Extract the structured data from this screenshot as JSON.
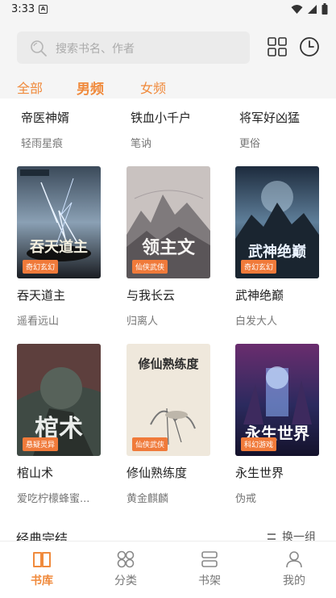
{
  "status_bar": {
    "time": "3:33",
    "notification_icon": "A"
  },
  "search": {
    "placeholder": "搜索书名、作者"
  },
  "tabs": [
    {
      "label": "全部",
      "active": false
    },
    {
      "label": "男频",
      "active": true
    },
    {
      "label": "女频",
      "active": false
    }
  ],
  "top_row": [
    {
      "title": "帝医神婿",
      "author": "轻雨星痕"
    },
    {
      "title": "铁血小千户",
      "author": "笔讷"
    },
    {
      "title": "将军好凶猛",
      "author": "更俗"
    }
  ],
  "row2": [
    {
      "title": "吞天道主",
      "author": "遥看远山",
      "genre": "奇幻玄幻",
      "cover_text": "吞天道主"
    },
    {
      "title": "与我长云",
      "author": "归离人",
      "genre": "仙侠武侠",
      "cover_text": "领主文"
    },
    {
      "title": "武神绝巅",
      "author": "白发大人",
      "genre": "奇幻玄幻",
      "cover_text": "武神绝巅"
    }
  ],
  "row3": [
    {
      "title": "棺山术",
      "author": "爱吃柠檬蜂蜜...",
      "genre": "悬疑灵异",
      "cover_text": "棺术"
    },
    {
      "title": "修仙熟练度",
      "author": "黄金麒麟",
      "genre": "仙侠武侠",
      "cover_text": "修仙熟练度"
    },
    {
      "title": "永生世界",
      "author": "伪戒",
      "genre": "科幻游戏",
      "cover_text": "永生世界"
    }
  ],
  "section": {
    "title": "经典完结",
    "more_label": "换一组"
  },
  "bottom_nav": [
    {
      "label": "书库",
      "icon": "book-open-icon",
      "active": true
    },
    {
      "label": "分类",
      "icon": "category-icon",
      "active": false
    },
    {
      "label": "书架",
      "icon": "bookshelf-icon",
      "active": false
    },
    {
      "label": "我的",
      "icon": "profile-icon",
      "active": false
    }
  ],
  "colors": {
    "accent": "#f08a3c",
    "badge": "#f07a3a"
  }
}
